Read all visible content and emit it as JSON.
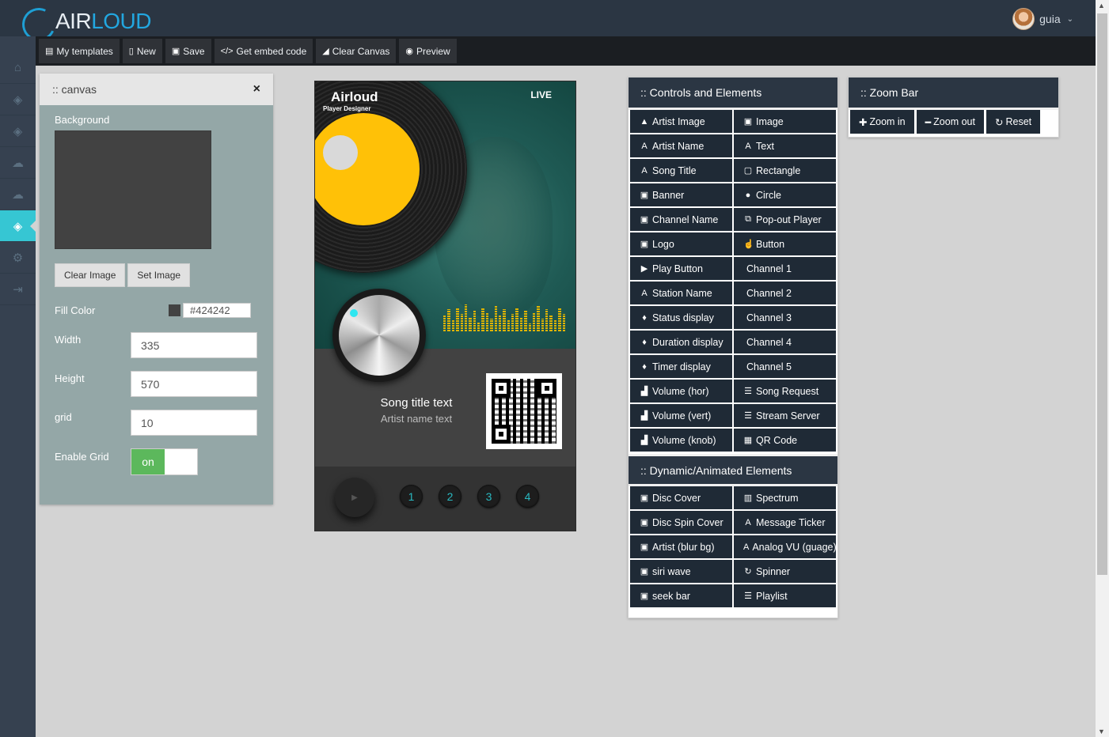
{
  "app": {
    "logo_main": "AIR",
    "logo_accent": "LOUD",
    "user_name": "guia"
  },
  "toolbar": {
    "my_templates": "My templates",
    "new": "New",
    "save": "Save",
    "embed": "Get embed code",
    "clear": "Clear Canvas",
    "preview": "Preview"
  },
  "canvas_panel": {
    "title": ":: canvas",
    "close": "×",
    "background_label": "Background",
    "clear_image": "Clear Image",
    "set_image": "Set Image",
    "fill_label": "Fill Color",
    "fill_value": "#424242",
    "width_label": "Width",
    "width_value": "335",
    "height_label": "Height",
    "height_value": "570",
    "grid_label": "grid",
    "grid_value": "10",
    "enable_grid_label": "Enable Grid",
    "toggle_on": "on"
  },
  "player": {
    "brand": "Airloud",
    "brand_sub": "Player Designer",
    "live": "LIVE",
    "song_title": "Song title text",
    "artist_name": "Artist name text",
    "channels": [
      "1",
      "2",
      "3",
      "4"
    ]
  },
  "controls": {
    "title": ":: Controls and Elements",
    "left": [
      "Artist Image",
      "Artist Name",
      "Song Title",
      "Banner",
      "Channel Name",
      "Logo",
      "Play Button",
      "Station Name",
      "Status display",
      "Duration display",
      "Timer display",
      "Volume (hor)",
      "Volume (vert)",
      "Volume (knob)"
    ],
    "right": [
      "Image",
      "Text",
      "Rectangle",
      "Circle",
      "Pop-out Player",
      "Button",
      "Channel 1",
      "Channel 2",
      "Channel 3",
      "Channel 4",
      "Channel 5",
      "Song Request",
      "Stream Server",
      "QR Code"
    ]
  },
  "dynamic": {
    "title": ":: Dynamic/Animated Elements",
    "left": [
      "Disc Cover",
      "Disc Spin Cover",
      "Artist (blur bg)",
      "siri wave",
      "seek bar"
    ],
    "right": [
      "Spectrum",
      "Message Ticker",
      "Analog VU (guage)",
      "Spinner",
      "Playlist"
    ]
  },
  "zoom": {
    "title": ":: Zoom Bar",
    "zoom_in": "Zoom in",
    "zoom_out": "Zoom out",
    "reset": "Reset"
  }
}
